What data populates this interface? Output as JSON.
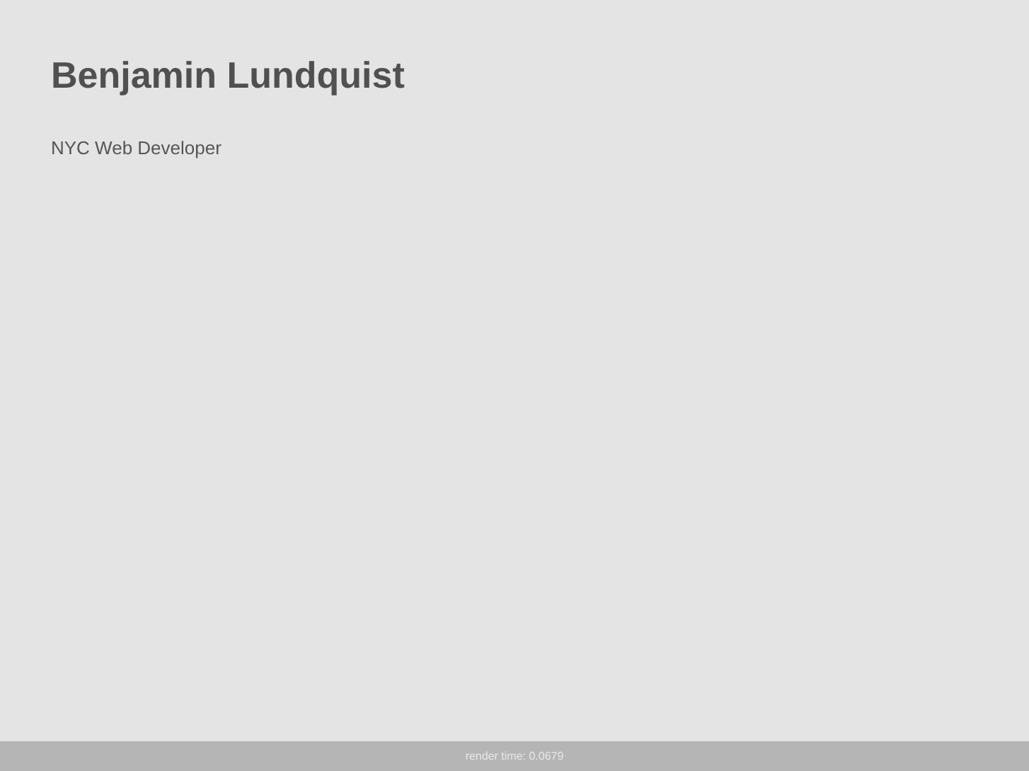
{
  "header": {
    "name": "Benjamin Lundquist",
    "tagline": "NYC Web Developer"
  },
  "footer": {
    "render_time": "render time: 0.0679"
  }
}
